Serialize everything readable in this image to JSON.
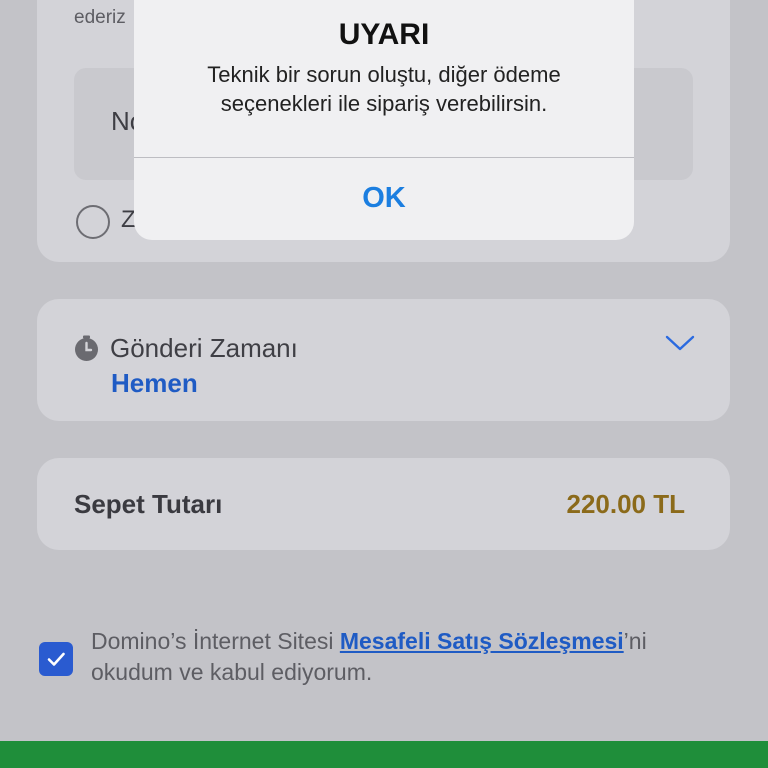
{
  "top_card": {
    "subtext": "ederiz",
    "note_placeholder": "No",
    "checkbox_label": "Z"
  },
  "delivery": {
    "label": "Gönderi Zamanı",
    "value": "Hemen"
  },
  "cart": {
    "label": "Sepet Tutarı",
    "amount": "220.00 TL"
  },
  "agreement": {
    "checked": true,
    "text_before": "Domino’s İnternet Sitesi ",
    "link_text": "Mesafeli Satış Sözleşmesi",
    "text_after": "’ni okudum ve kabul ediyorum."
  },
  "alert": {
    "title": "UYARI",
    "message": "Teknik bir sorun oluştu, diğer ödeme seçenekleri ile sipariş verebilirsin.",
    "ok_label": "OK"
  },
  "colors": {
    "accent_blue": "#1f5bc4",
    "price_gold": "#8b6a1a",
    "bottom_bar_green": "#1f8e3a",
    "alert_button_blue": "#1b7ee0"
  },
  "icons": {
    "delivery_icon": "clock-icon",
    "dropdown_icon": "chevron-down-icon",
    "agree_icon": "checkmark-icon"
  }
}
